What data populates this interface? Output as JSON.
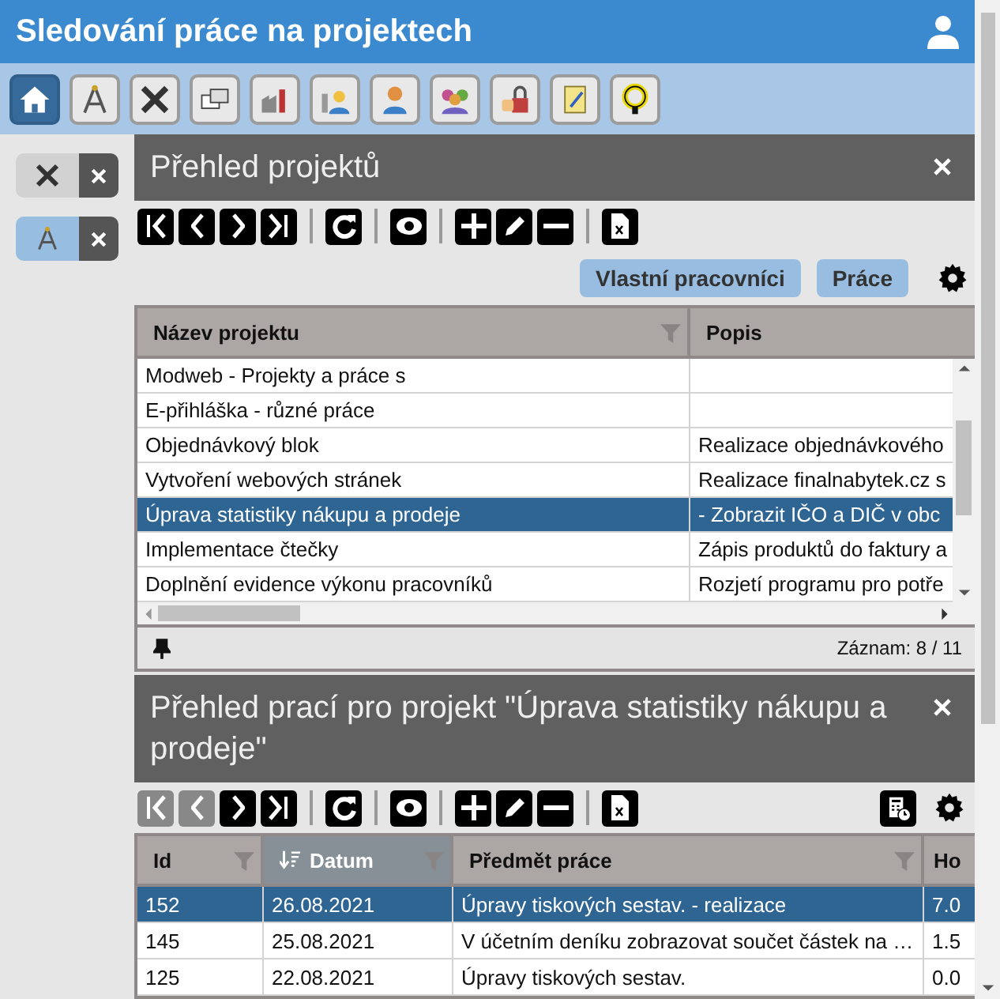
{
  "header": {
    "title": "Sledování práce na projektech"
  },
  "nav": [
    {
      "selected": true
    },
    {
      "selected": false
    },
    {
      "selected": false
    },
    {
      "selected": false
    },
    {
      "selected": false
    },
    {
      "selected": false
    },
    {
      "selected": false
    },
    {
      "selected": false
    },
    {
      "selected": false
    },
    {
      "selected": false
    },
    {
      "selected": false
    }
  ],
  "sidebar_tabs": [
    {
      "selected": false
    },
    {
      "selected": true
    }
  ],
  "projects_panel": {
    "title": "Přehled projektů",
    "toolbar": [
      {
        "disabled": false
      },
      {
        "disabled": false
      },
      {
        "disabled": false
      },
      {
        "disabled": false
      },
      {
        "disabled": false
      },
      {
        "disabled": false
      },
      {
        "disabled": false
      },
      {
        "disabled": false
      },
      {
        "disabled": false
      },
      {
        "disabled": false
      }
    ],
    "actions": [
      "Vlastní pracovníci",
      "Práce"
    ],
    "table": {
      "columns": [
        {
          "label": "Název projektu",
          "filter": true
        },
        {
          "label": "Popis",
          "filter": false
        }
      ],
      "rows": [
        {
          "cells": [
            "Modweb - Projekty a práce s",
            ""
          ],
          "selected": false
        },
        {
          "cells": [
            "E-přihláška - různé práce",
            ""
          ],
          "selected": false
        },
        {
          "cells": [
            "Objednávkový blok",
            "Realizace objednávkového"
          ],
          "selected": false
        },
        {
          "cells": [
            "Vytvoření webových stránek",
            "Realizace finalnabytek.cz s"
          ],
          "selected": false
        },
        {
          "cells": [
            "Úprava statistiky nákupu a prodeje",
            "- Zobrazit IČO a DIČ v obc"
          ],
          "selected": true
        },
        {
          "cells": [
            "Implementace čtečky",
            "Zápis produktů do faktury a"
          ],
          "selected": false
        },
        {
          "cells": [
            "Doplnění evidence výkonu pracovníků",
            "Rozjetí programu pro potře"
          ],
          "selected": false
        }
      ]
    },
    "status": "Záznam: 8 / 11"
  },
  "works_panel": {
    "title": "Přehled prací pro projekt \"Úprava statistiky nákupu a prodeje\"",
    "toolbar": [
      {
        "disabled": true
      },
      {
        "disabled": true
      },
      {
        "disabled": false
      },
      {
        "disabled": false
      },
      {
        "disabled": false
      },
      {
        "disabled": false
      },
      {
        "disabled": false
      },
      {
        "disabled": false
      },
      {
        "disabled": false
      },
      {
        "disabled": false
      }
    ],
    "table": {
      "columns": [
        {
          "label": "Id",
          "filter": true,
          "sorted": false
        },
        {
          "label": "Datum",
          "filter": true,
          "sorted": true
        },
        {
          "label": "Předmět práce",
          "filter": true,
          "sorted": false
        },
        {
          "label": "Ho",
          "filter": false,
          "sorted": false
        }
      ],
      "rows": [
        {
          "cells": [
            "152",
            "26.08.2021",
            "Úpravy tiskových sestav. - realizace",
            "7.0"
          ],
          "selected": true
        },
        {
          "cells": [
            "145",
            "25.08.2021",
            "V účetním deníku zobrazovat součet částek na …",
            "1.5"
          ],
          "selected": false
        },
        {
          "cells": [
            "125",
            "22.08.2021",
            "Úpravy tiskových sestav.",
            "0.0"
          ],
          "selected": false
        }
      ]
    }
  }
}
